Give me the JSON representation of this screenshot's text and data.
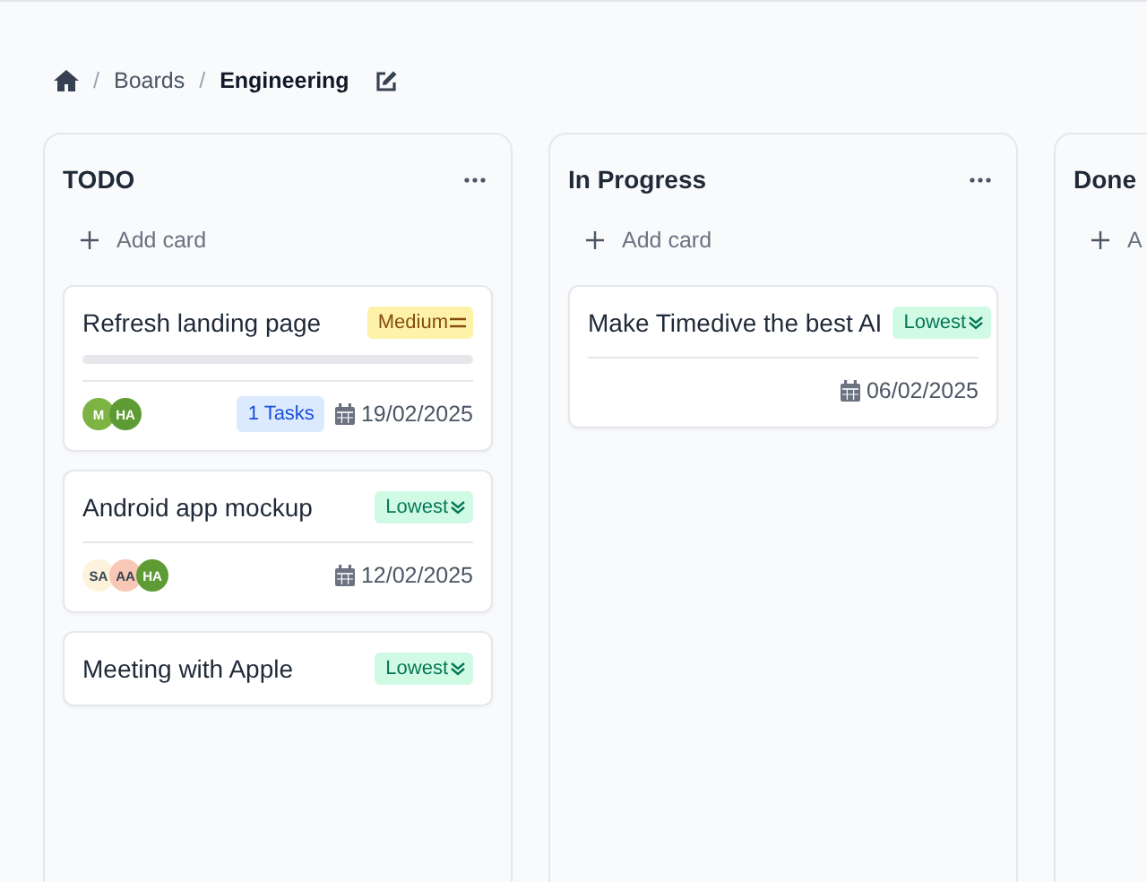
{
  "breadcrumb": {
    "items": [
      {
        "kind": "link",
        "separator": "/",
        "label": "Boards"
      },
      {
        "kind": "current",
        "separator": "/",
        "label": "Engineering"
      }
    ]
  },
  "columns": [
    {
      "title": "TODO",
      "add_label": "Add card",
      "has_menu": true,
      "cards": [
        {
          "title": "Refresh landing page",
          "priority": {
            "kind": "medium",
            "label": "Medium"
          },
          "progress": {
            "level": 0
          },
          "avatars": [
            {
              "initials": "M",
              "color": "#7cb342"
            },
            {
              "initials": "HA",
              "color": "#5e9b34"
            }
          ],
          "tasks": "1 Tasks",
          "date": "19/02/2025"
        },
        {
          "title": "Android app mockup",
          "priority": {
            "kind": "lowest",
            "label": "Lowest"
          },
          "avatars": [
            {
              "initials": "SA",
              "color": "#fdf2dc"
            },
            {
              "initials": "AA",
              "color": "#f9c7b5"
            },
            {
              "initials": "HA",
              "color": "#5e9b34"
            }
          ],
          "date": "12/02/2025"
        },
        {
          "title": "Meeting with Apple",
          "priority": {
            "kind": "lowest",
            "label": "Lowest"
          }
        }
      ]
    },
    {
      "title": "In Progress",
      "add_label": "Add card",
      "has_menu": true,
      "cards": [
        {
          "title": "Make Timedive the best AI",
          "priority": {
            "kind": "lowest",
            "label": "Lowest"
          },
          "date": "06/02/2025"
        }
      ]
    },
    {
      "title": "Done",
      "add_label": "A"
    }
  ]
}
